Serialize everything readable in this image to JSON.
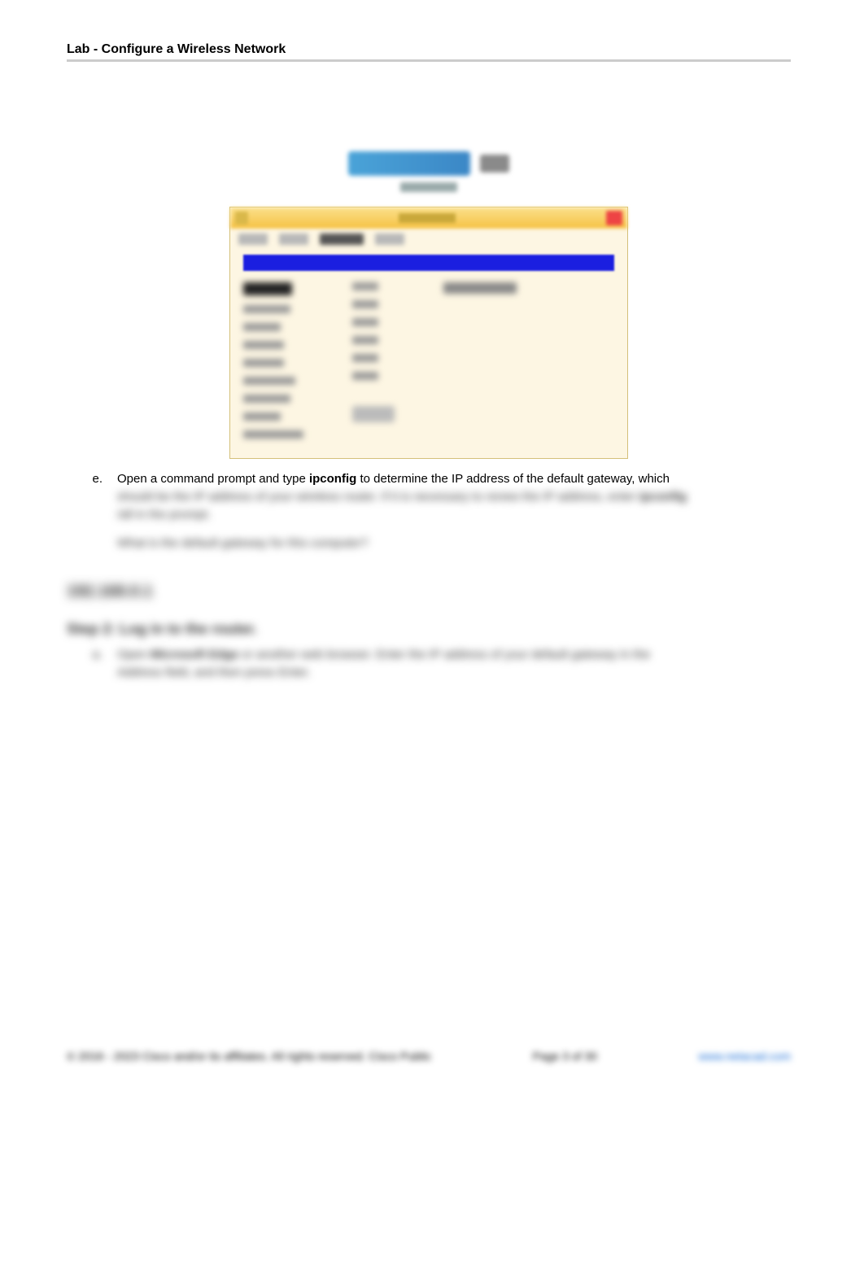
{
  "header": {
    "title": "Lab - Configure a Wireless Network"
  },
  "item_e": {
    "marker": "e.",
    "text_pre": "Open a command prompt and type ",
    "cmd": "ipconfig",
    "text_post": " to determine the IP address of the default gateway, which ",
    "blur1": "should be the IP address of your wireless router. If it is necessary to renew the IP address, enter ",
    "blur1_bold": "ipconfig",
    "blur2": "/all in the prompt.",
    "question": "What is the default gateway for this computer?"
  },
  "answer_block": "192.168.0.1",
  "step": {
    "heading": "Step 2: Log in to the router.",
    "marker": "a.",
    "a_pre": "Open ",
    "a_bold": "Microsoft Edge",
    "a_mid": " or another web browser. Enter the IP address of your default gateway in the ",
    "a_tail": "Address field, and then press Enter."
  },
  "footer": {
    "left": "© 2016 - 2023 Cisco and/or its affiliates. All rights reserved. Cisco Public",
    "mid": "Page 3 of 30",
    "right": "www.netacad.com"
  }
}
